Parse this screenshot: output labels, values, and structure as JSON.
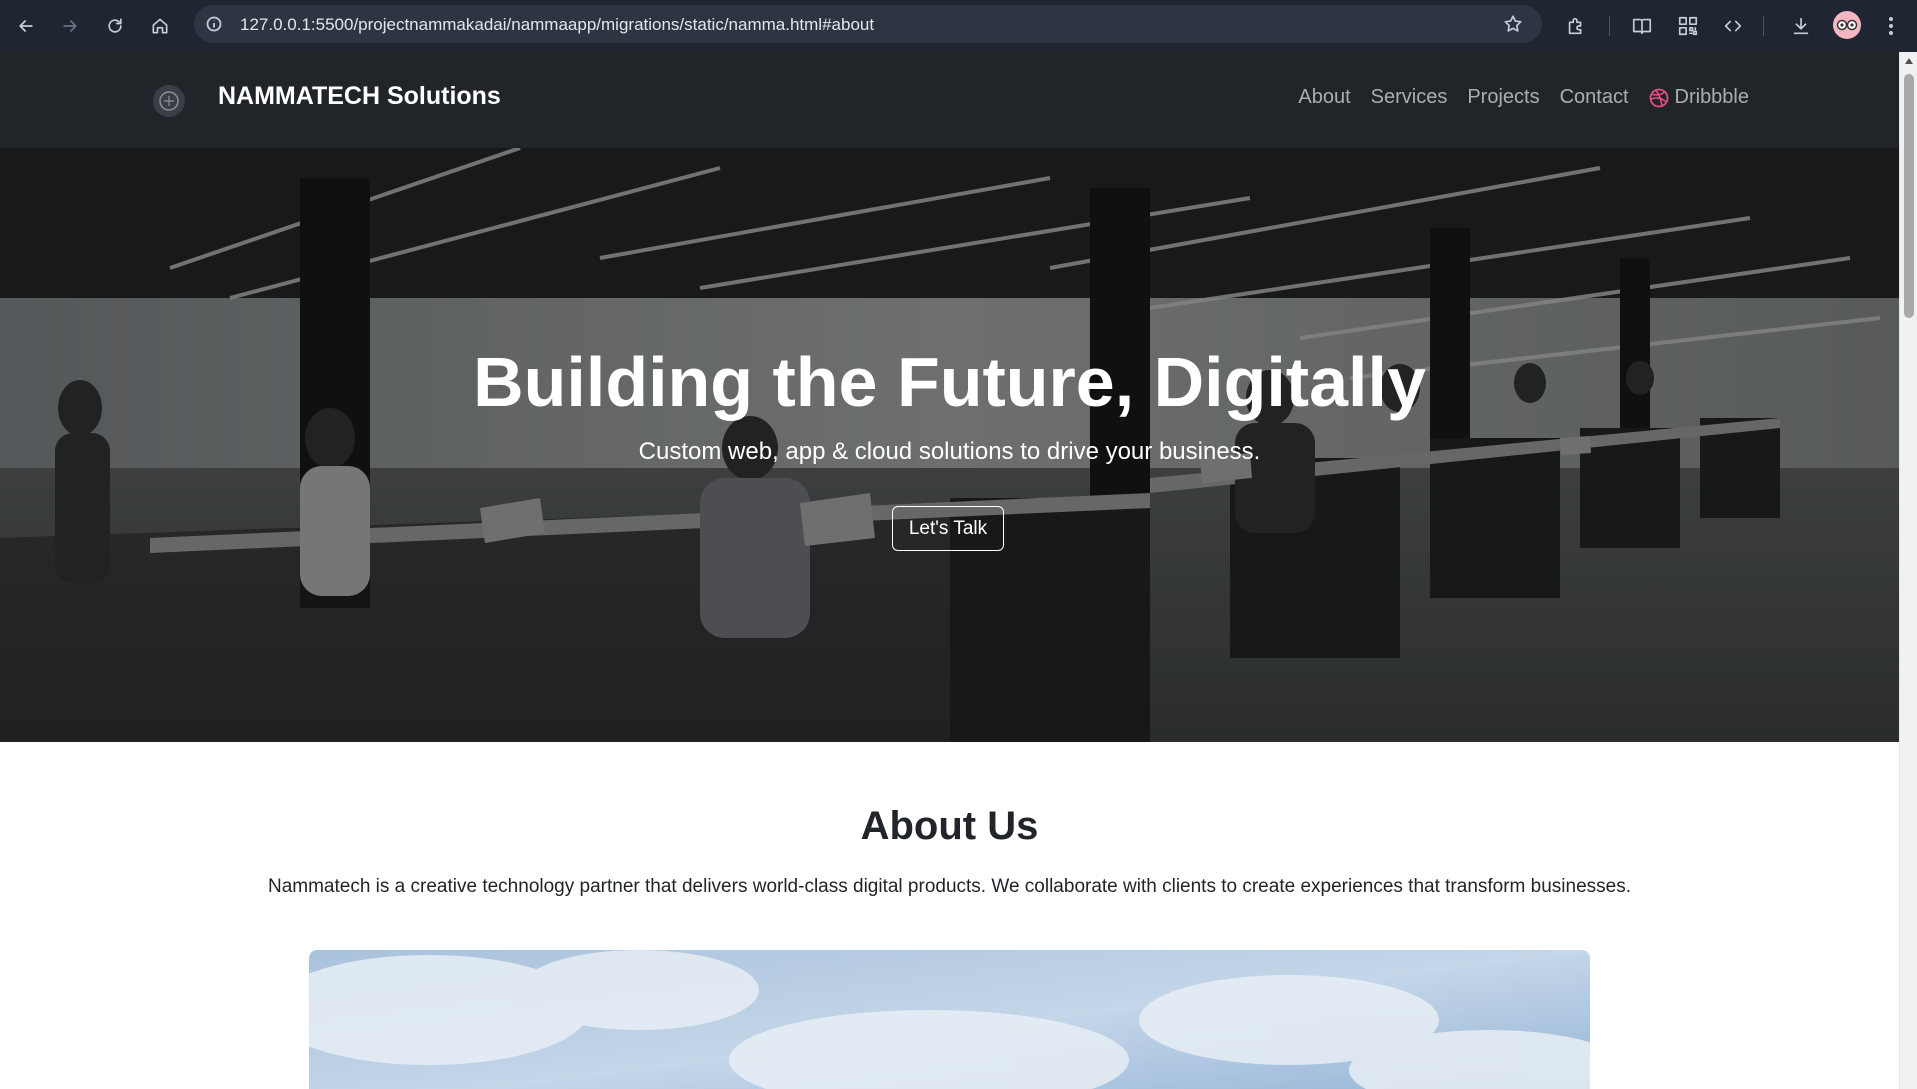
{
  "browser": {
    "url": "127.0.0.1:5500/projectnammakadai/nammaapp/migrations/static/namma.html#about",
    "icons": [
      "back-icon",
      "forward-icon",
      "reload-icon",
      "home-icon",
      "site-info-icon",
      "bookmark-star-icon",
      "extensions-icon",
      "reading-list-icon",
      "qr-code-icon",
      "devtools-icon",
      "download-icon",
      "profile-avatar",
      "menu-icon"
    ]
  },
  "navbar": {
    "brand": "NAMMATECH Solutions",
    "links": [
      {
        "label": "About"
      },
      {
        "label": "Services"
      },
      {
        "label": "Projects"
      },
      {
        "label": "Contact"
      },
      {
        "label": "Dribbble",
        "icon": "dribbble-icon",
        "icon_color": "#ea4c89"
      }
    ]
  },
  "hero": {
    "title": "Building the Future, Digitally",
    "subtitle": "Custom web, app & cloud solutions to drive your business.",
    "cta": "Let's Talk"
  },
  "about": {
    "title": "About Us",
    "text": "Nammatech is a creative technology partner that delivers world-class digital products. We collaborate with clients to create experiences that transform businesses."
  },
  "colors": {
    "chrome_bg": "#202631",
    "navbar_bg": "#212529",
    "text_dark": "#212529"
  }
}
